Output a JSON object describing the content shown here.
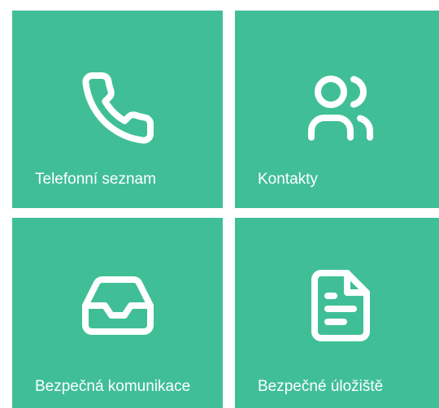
{
  "colors": {
    "tile_background": "#40bf97",
    "icon": "#ffffff",
    "label": "#ffffff"
  },
  "tiles": [
    {
      "label": "Telefonní seznam",
      "icon": "phone-icon"
    },
    {
      "label": "Kontakty",
      "icon": "users-icon"
    },
    {
      "label": "Bezpečná komunikace",
      "icon": "inbox-icon"
    },
    {
      "label": "Bezpečné úložiště",
      "icon": "document-icon"
    }
  ]
}
